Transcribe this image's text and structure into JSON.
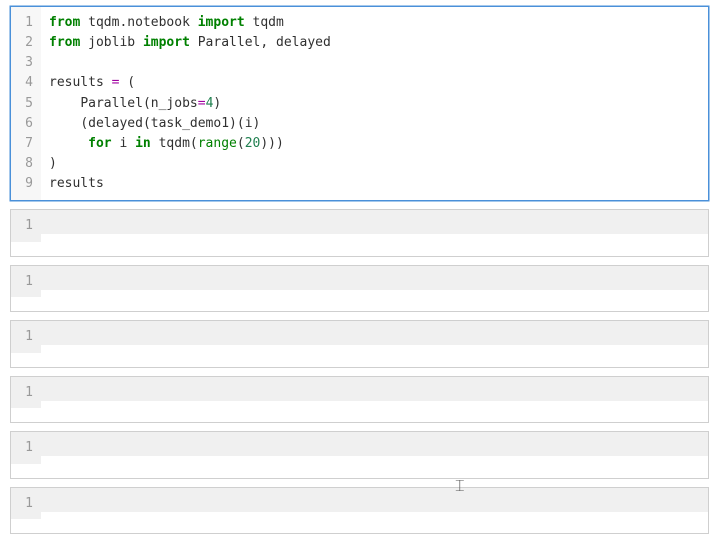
{
  "main_cell": {
    "gutter": [
      "1",
      "2",
      "3",
      "4",
      "5",
      "6",
      "7",
      "8",
      "9"
    ],
    "tokens": {
      "l1": {
        "kw1": "from",
        "mod": "tqdm",
        "dot": ".",
        "attr": "notebook",
        "kw2": "import",
        "imp": "tqdm"
      },
      "l2": {
        "kw1": "from",
        "mod": "joblib",
        "kw2": "import",
        "imp1": "Parallel",
        "comma": ", ",
        "imp2": "delayed"
      },
      "l4": {
        "name": "results",
        "eq": "=",
        "paren": "("
      },
      "l5": {
        "call": "Parallel",
        "open": "(",
        "arg": "n_jobs",
        "assign": "=",
        "val": "4",
        "close": ")"
      },
      "l6": {
        "open": "(",
        "fn1": "delayed",
        "open2": "(",
        "arg": "task_demo1",
        "close2": ")",
        "open3": "(",
        "var": "i",
        "close3": ")"
      },
      "l7": {
        "kw1": "for",
        "var": "i",
        "kw2": "in",
        "fn": "tqdm",
        "open": "(",
        "rng": "range",
        "open2": "(",
        "val": "20",
        "close": ")))"
      },
      "l8": {
        "paren": ")"
      },
      "l9": {
        "name": "results"
      }
    }
  },
  "output_cells": [
    {
      "gutter": "1"
    },
    {
      "gutter": "1"
    },
    {
      "gutter": "1"
    },
    {
      "gutter": "1"
    },
    {
      "gutter": "1"
    },
    {
      "gutter": "1"
    }
  ]
}
